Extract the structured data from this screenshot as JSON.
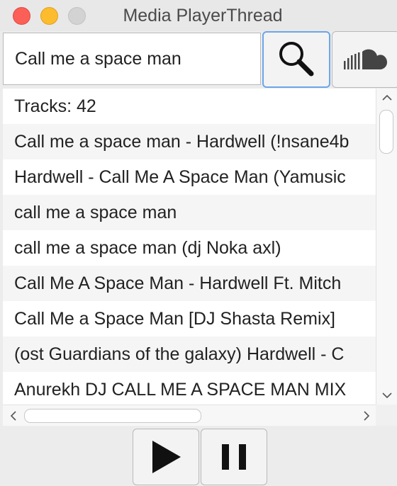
{
  "window": {
    "title": "Media PlayerThread"
  },
  "search": {
    "query": "Call me a space man",
    "search_icon": "magnifier-icon",
    "soundcloud_icon": "soundcloud-icon"
  },
  "tracks": {
    "header": "Tracks: 42",
    "items": [
      "Call me a space man - Hardwell (!nsane4b",
      "Hardwell - Call Me A Space Man (Yamusic",
      "call me a space man",
      "call me a space man (dj Noka axl)",
      "Call Me A Space Man - Hardwell Ft. Mitch",
      "Call Me a Space Man [DJ Shasta Remix]",
      "(ost Guardians of the galaxy) Hardwell - C",
      "Anurekh DJ CALL ME A SPACE MAN MIX"
    ]
  },
  "controls": {
    "play_icon": "play-icon",
    "pause_icon": "pause-icon"
  },
  "colors": {
    "close": "#fc5f57",
    "minimize": "#fdbc2e",
    "maximize": "#d3d3d3",
    "focus_ring": "#6aa7e8"
  }
}
